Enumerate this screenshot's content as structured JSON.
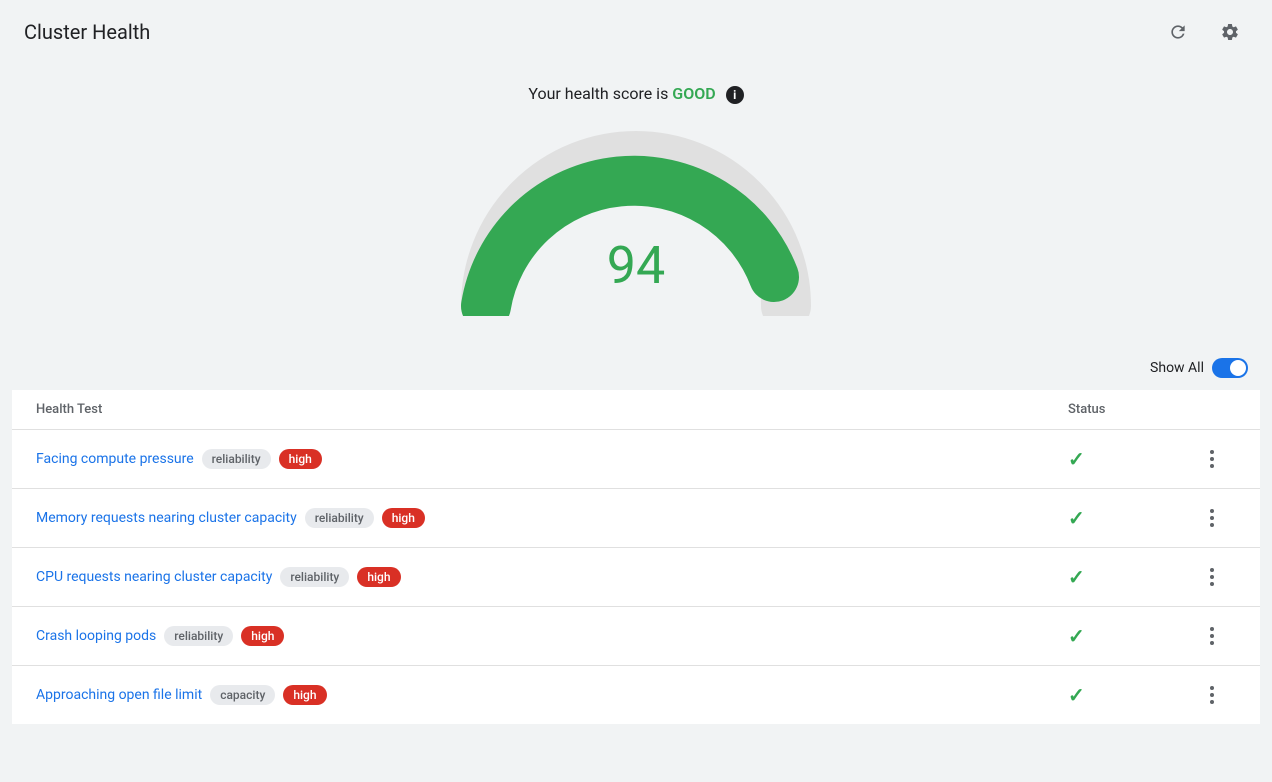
{
  "header": {
    "title": "Cluster Health",
    "refresh_icon": "refresh-icon",
    "settings_icon": "settings-icon"
  },
  "score_section": {
    "label_prefix": "Your health score is",
    "status": "GOOD",
    "info_icon_label": "i",
    "score": "94",
    "gauge_color": "#34a853",
    "gauge_bg_color": "#e0e0e0"
  },
  "show_all": {
    "label": "Show All",
    "toggle_on": true
  },
  "table": {
    "col_test": "Health Test",
    "col_status": "Status",
    "rows": [
      {
        "name": "Facing compute pressure",
        "category": "reliability",
        "severity": "high",
        "status": "ok"
      },
      {
        "name": "Memory requests nearing cluster capacity",
        "category": "reliability",
        "severity": "high",
        "status": "ok"
      },
      {
        "name": "CPU requests nearing cluster capacity",
        "category": "reliability",
        "severity": "high",
        "status": "ok"
      },
      {
        "name": "Crash looping pods",
        "category": "reliability",
        "severity": "high",
        "status": "ok"
      },
      {
        "name": "Approaching open file limit",
        "category": "capacity",
        "severity": "high",
        "status": "ok"
      }
    ]
  }
}
